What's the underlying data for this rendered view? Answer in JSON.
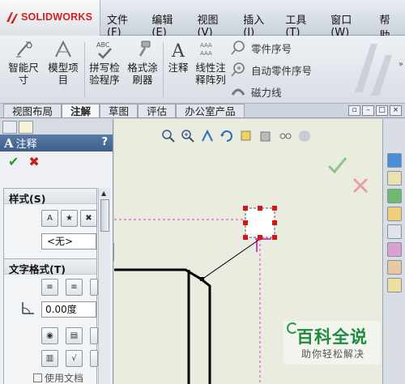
{
  "app": {
    "brand": "SOLIDWORKS",
    "menu": [
      "文件(F)",
      "编辑(E)",
      "视图(V)",
      "插入(I)",
      "工具(T)",
      "窗口(W)",
      "帮助"
    ]
  },
  "ribbon": {
    "smart_dimension": "智能尺\n寸",
    "model_items": "模型项\n目",
    "spell_check": "拼写检\n验程序",
    "format_painter": "格式涂\n刷器",
    "note": "注释",
    "linear_note_array": "线性注\n释阵列",
    "balloon": "零件序号",
    "auto_balloon": "自动零件序号",
    "magnetic_line": "磁力线"
  },
  "tabs": {
    "items": [
      "视图布局",
      "注解",
      "草图",
      "评估",
      "办公室产品"
    ],
    "active": "注解"
  },
  "property_manager": {
    "title": "注释",
    "help": "?",
    "ok": "✔",
    "cancel": "✖",
    "style_group": "样式(S)",
    "style_value": "<无>",
    "text_format_group": "文字格式(T)",
    "angle_value": "0.00度",
    "use_doc_font": "使用文档"
  },
  "watermark": {
    "title": "百科全说",
    "subtitle": "助你轻松解决"
  },
  "colors": {
    "brand_red": "#d32020",
    "header_blue": "#4a6a96",
    "canvas_bg": "#e9ecdf",
    "selection_red": "#d01818",
    "accent_magenta": "#d040c0"
  }
}
